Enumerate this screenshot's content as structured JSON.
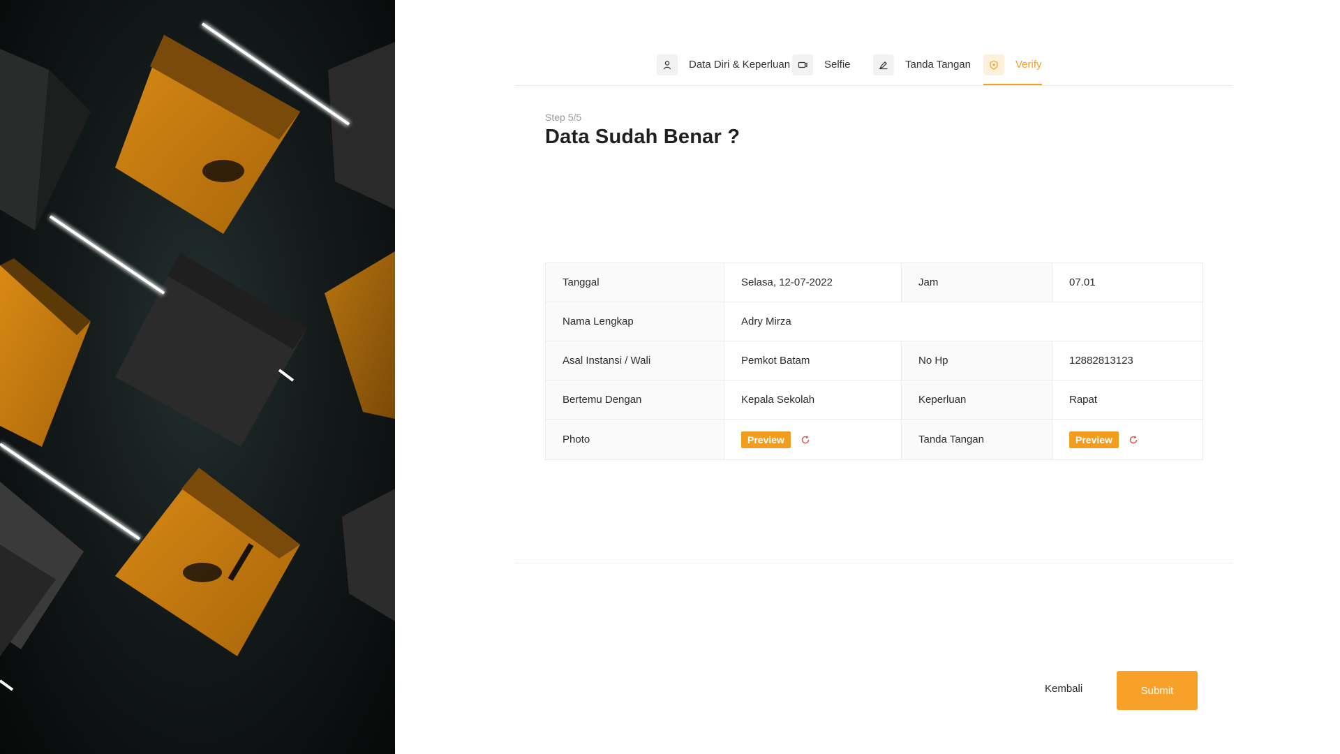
{
  "stepper": {
    "steps": [
      {
        "label": "Data Diri & Keperluan",
        "icon": "user-icon"
      },
      {
        "label": "Selfie",
        "icon": "camera-icon"
      },
      {
        "label": "Tanda Tangan",
        "icon": "pen-icon"
      },
      {
        "label": "Verify",
        "icon": "shield-icon"
      }
    ],
    "active_index": 3
  },
  "header": {
    "step_count": "Step 5/5",
    "title": "Data Sudah Benar ?"
  },
  "summary": {
    "tanggal_label": "Tanggal",
    "tanggal_value": "Selasa, 12-07-2022",
    "jam_label": "Jam",
    "jam_value": "07.01",
    "nama_label": "Nama Lengkap",
    "nama_value": "Adry Mirza",
    "instansi_label": "Asal Instansi / Wali",
    "instansi_value": "Pemkot Batam",
    "hp_label": "No Hp",
    "hp_value": "12882813123",
    "bertemu_label": "Bertemu Dengan",
    "bertemu_value": "Kepala Sekolah",
    "keperluan_label": "Keperluan",
    "keperluan_value": "Rapat",
    "photo_label": "Photo",
    "ttd_label": "Tanda Tangan",
    "preview_label": "Preview"
  },
  "actions": {
    "back_label": "Kembali",
    "submit_label": "Submit"
  },
  "colors": {
    "accent": "#f29d1f",
    "refresh": "#e0523a"
  }
}
